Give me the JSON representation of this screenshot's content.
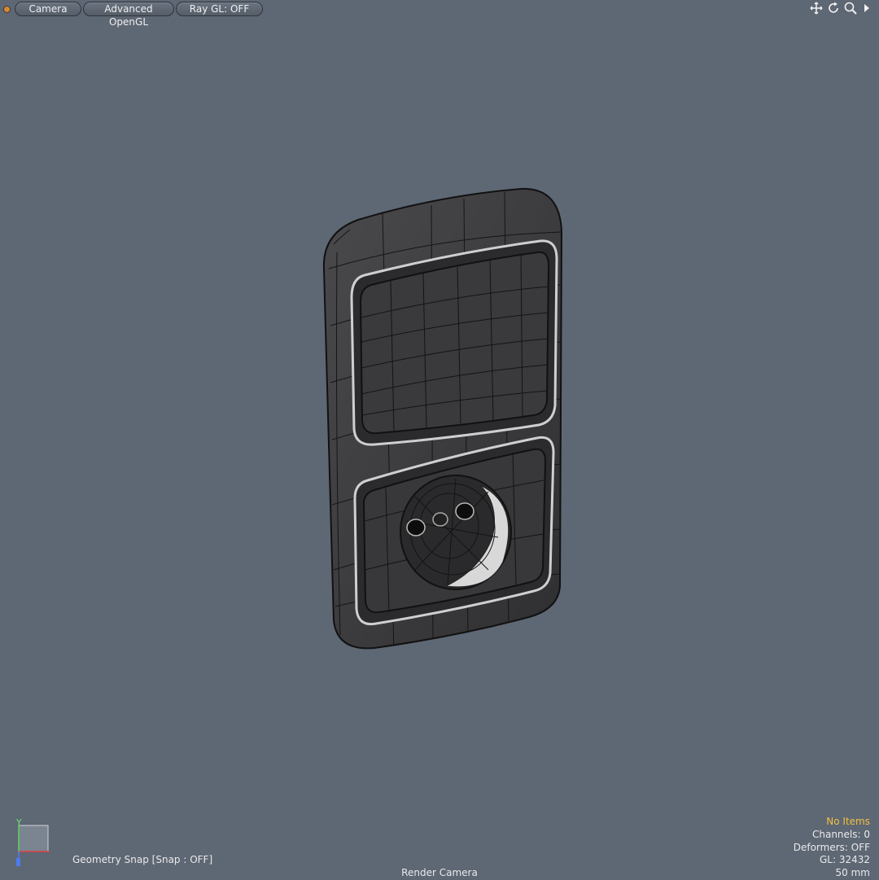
{
  "toolbar": {
    "camera_label": "Camera",
    "opengl_label": "Advanced OpenGL",
    "raygl_label": "Ray GL: OFF",
    "tools": [
      "move-view-icon",
      "rotate-view-icon",
      "zoom-view-icon",
      "more-arrow-icon"
    ]
  },
  "viewport": {
    "snap_label": "Geometry Snap  [Snap : OFF]",
    "camera_name": "Render Camera",
    "axis_y_label": "Y"
  },
  "stats": {
    "selection": "No Items",
    "channels": "Channels: 0",
    "deformers": "Deformers: OFF",
    "gl": "GL: 32432",
    "focal": "50 mm"
  },
  "colors": {
    "background": "#5e6774",
    "model_fill": "#3c3c3e",
    "wire": "#111111",
    "highlight_text": "#f0c040"
  },
  "model": {
    "name": "socket-switch-plate-wireframe",
    "icon": "3d-mesh"
  }
}
